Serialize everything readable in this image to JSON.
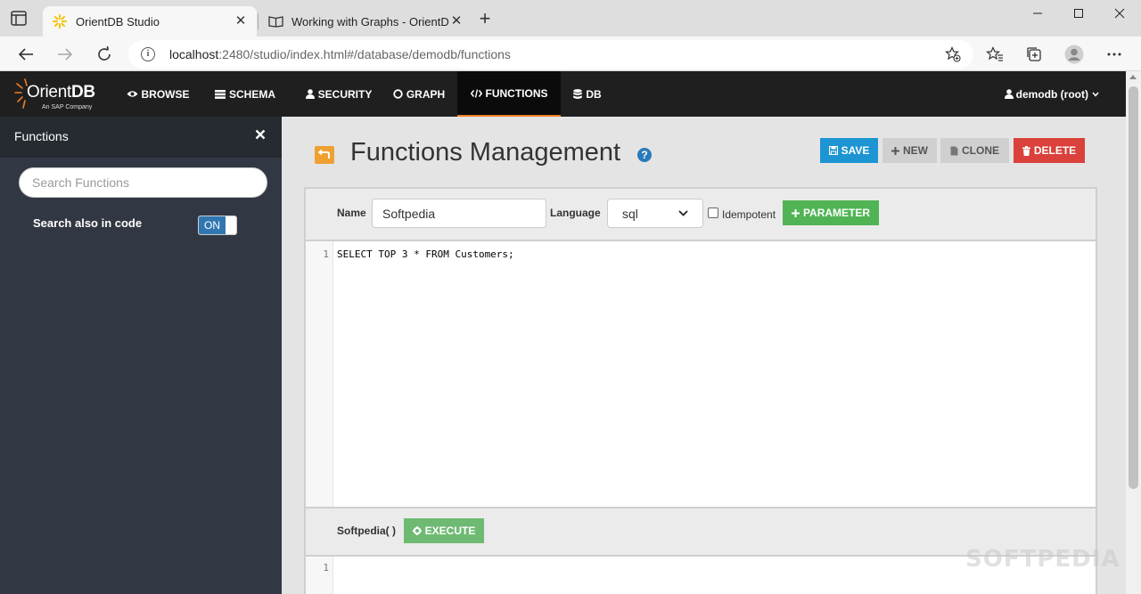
{
  "browser": {
    "tabs": [
      {
        "title": "OrientDB Studio",
        "active": true,
        "icon": "orientdb-star-icon"
      },
      {
        "title": "Working with Graphs - OrientDB",
        "active": false,
        "icon": "book-icon"
      }
    ],
    "url_host": "localhost",
    "url_rest": ":2480/studio/index.html#/database/demodb/functions"
  },
  "app": {
    "logo_text_prefix": "Orient",
    "logo_text_suffix": "DB",
    "logo_sub": "An SAP Company",
    "nav": [
      {
        "label": "BROWSE",
        "icon": "eye-icon"
      },
      {
        "label": "SCHEMA",
        "icon": "table-icon"
      },
      {
        "label": "SECURITY",
        "icon": "user-icon"
      },
      {
        "label": "GRAPH",
        "icon": "circle-icon"
      },
      {
        "label": "FUNCTIONS",
        "icon": "code-icon",
        "active": true
      },
      {
        "label": "DB",
        "icon": "database-icon"
      }
    ],
    "user": "demodb (root)",
    "accent": "#ef7d22"
  },
  "sidebar": {
    "title": "Functions",
    "search_placeholder": "Search Functions",
    "search_also_label": "Search also in code",
    "toggle_label": "ON"
  },
  "main": {
    "title": "Functions Management",
    "buttons": {
      "save": "SAVE",
      "new": "NEW",
      "clone": "CLONE",
      "delete": "DELETE",
      "parameter": "PARAMETER",
      "execute": "EXECUTE"
    },
    "form": {
      "name_label": "Name",
      "name_value": "Softpedia",
      "language_label": "Language",
      "language_value": "sql",
      "idempotent_label": "Idempotent"
    },
    "code": {
      "line_numbers": [
        "1"
      ],
      "lines": [
        "SELECT TOP 3 * FROM Customers;"
      ]
    },
    "exec_label": "Softpedia( )",
    "result_line_numbers": [
      "1"
    ]
  },
  "watermark": "SOFTPEDIA"
}
